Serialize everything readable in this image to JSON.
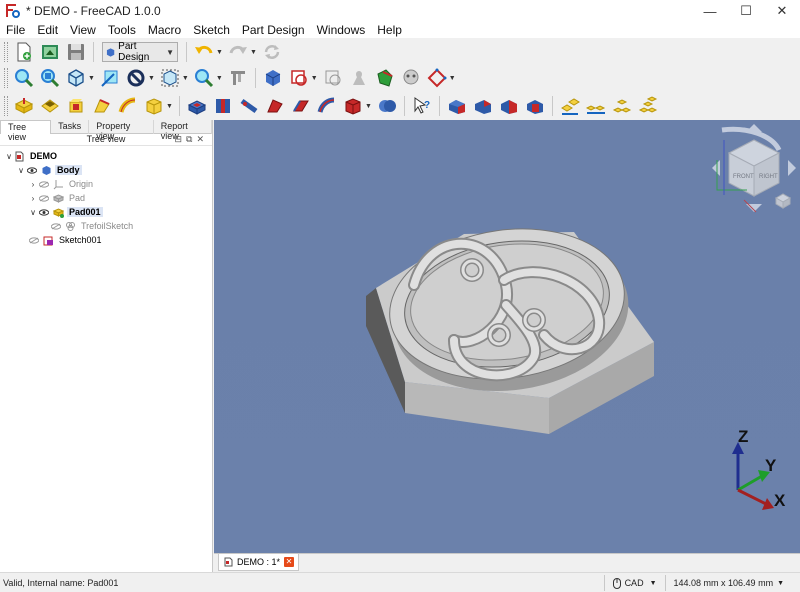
{
  "window": {
    "title": "* DEMO - FreeCAD 1.0.0",
    "minimize_glyph": "—",
    "maximize_glyph": "☐",
    "close_glyph": "✕"
  },
  "menu": [
    "File",
    "Edit",
    "View",
    "Tools",
    "Macro",
    "Sketch",
    "Part Design",
    "Windows",
    "Help"
  ],
  "toolbar": {
    "workbench": "Part Design"
  },
  "left_panel": {
    "tabs": [
      "Tree view",
      "Tasks",
      "Property view",
      "Report view"
    ],
    "header": "Tree view",
    "tree": {
      "doc": "DEMO",
      "body": "Body",
      "origin": "Origin",
      "pad": "Pad",
      "pad001": "Pad001",
      "trefoil": "TrefoilSketch",
      "sketch001": "Sketch001"
    }
  },
  "view": {
    "axes": {
      "z": "Z",
      "y": "Y",
      "x": "X"
    },
    "cube_faces": {
      "front": "FRONT",
      "right": "RIGHT"
    },
    "colors": {
      "background": "#6b81ab",
      "part_top": "#c8c8c8",
      "part_side": "#b5b5b5",
      "part_dark": "#5a5a5a",
      "axis_z": "#1f2e8f",
      "axis_y": "#1e9e2a",
      "axis_x": "#a32020"
    }
  },
  "doc_tab": {
    "label": "DEMO : 1*",
    "close": "✕"
  },
  "status": {
    "message": "Valid, Internal name: Pad001",
    "nav_style": "CAD",
    "dimensions": "144.08 mm x 106.49 mm"
  }
}
